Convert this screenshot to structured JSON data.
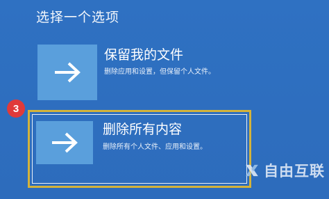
{
  "page": {
    "title": "选择一个选项"
  },
  "options": [
    {
      "title": "保留我的文件",
      "description": "删除应用和设置，但保留个人文件。",
      "icon": "arrow-right-icon"
    },
    {
      "title": "删除所有内容",
      "description": "删除所有个人文件、应用和设置。",
      "icon": "arrow-right-icon"
    }
  ],
  "annotation": {
    "step": "3",
    "badge_color": "#e03a3a",
    "frame_color": "#d4b33a"
  },
  "watermark": {
    "text": "自由互联",
    "logo": "x-logo-icon"
  },
  "colors": {
    "background": "#2f6fbf",
    "tile": "#5a9fdc"
  }
}
